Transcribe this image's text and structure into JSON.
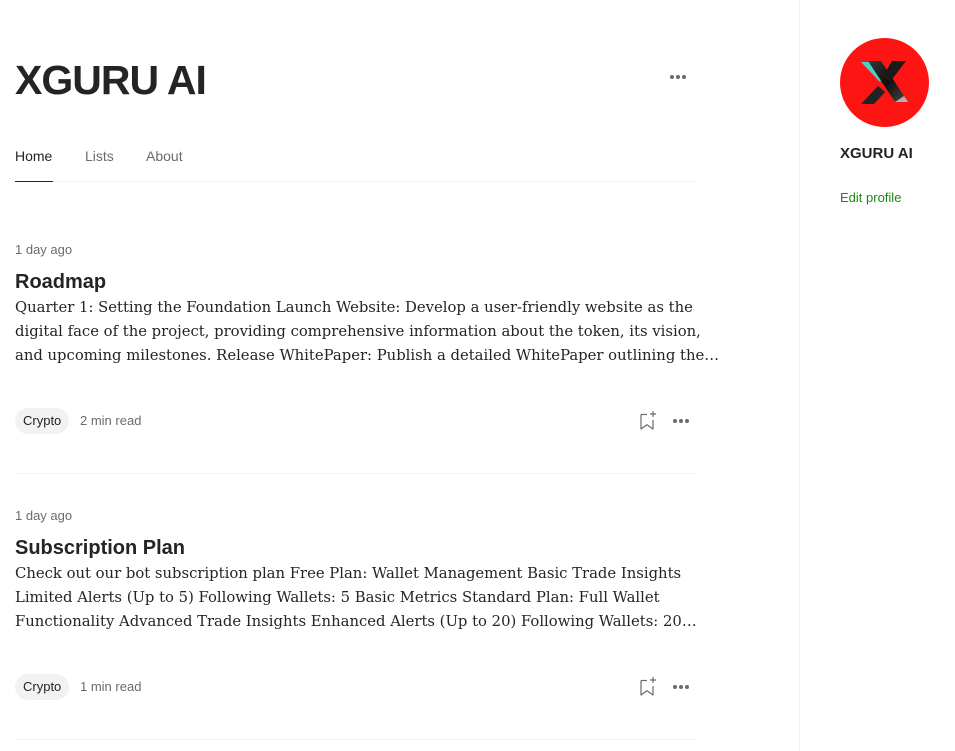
{
  "publication": {
    "name": "XGURU AI"
  },
  "tabs": [
    {
      "label": "Home",
      "active": true
    },
    {
      "label": "Lists",
      "active": false
    },
    {
      "label": "About",
      "active": false
    }
  ],
  "articles": [
    {
      "date": "1 day ago",
      "title": "Roadmap",
      "excerpt_lines": [
        "Quarter 1: Setting the Foundation Launch Website: Develop a user-friendly website as the",
        "digital face of the project, providing comprehensive information about the token, its vision,",
        "and upcoming milestones. Release WhitePaper: Publish a detailed WhitePaper outlining the…"
      ],
      "tag": "Crypto",
      "read_time": "2 min read"
    },
    {
      "date": "1 day ago",
      "title": "Subscription Plan",
      "excerpt_lines": [
        "Check out our bot subscription plan Free Plan: Wallet Management Basic Trade Insights",
        "Limited Alerts (Up to 5) Following Wallets: 5 Basic Metrics Standard Plan: Full Wallet",
        "Functionality Advanced Trade Insights Enhanced Alerts (Up to 20) Following Wallets: 20…"
      ],
      "tag": "Crypto",
      "read_time": "1 min read"
    }
  ],
  "sidebar": {
    "name": "XGURU AI",
    "edit_profile_label": "Edit profile",
    "avatar_icon": "xguru-logo-icon"
  },
  "colors": {
    "text": "#242424",
    "muted": "#6b6b6b",
    "accent_green": "#1a8917",
    "avatar_red": "#ff1414",
    "tag_bg": "#f2f2f2"
  },
  "icons": {
    "header_more": "more-horizontal-icon",
    "bookmark": "bookmark-add-icon",
    "article_more": "more-horizontal-icon"
  }
}
